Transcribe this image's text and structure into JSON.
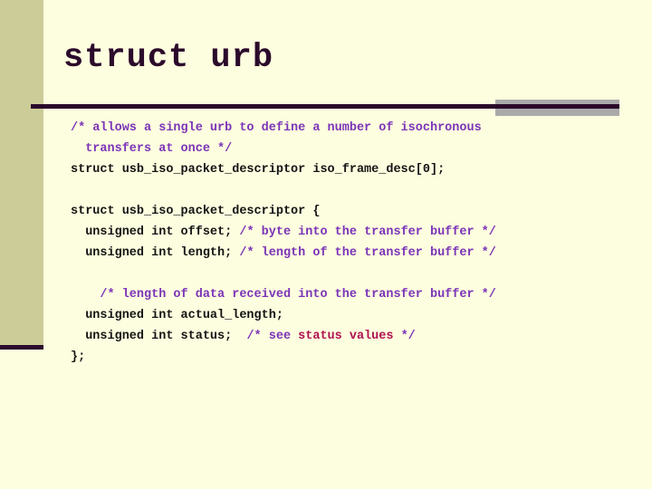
{
  "slide": {
    "title": "struct urb",
    "colors": {
      "background": "#fdfddf",
      "sidebar": "#cccc99",
      "sidebar_cap": "#2b0a2b",
      "title_text": "#2b0a2b",
      "rule": "#2b0a2b",
      "rule_shadow": "#aaaaaa",
      "code_text": "#141414",
      "comment_text": "#7b34b8",
      "status_text": "#b01050"
    }
  },
  "code": {
    "lines": [
      {
        "id": "line-1",
        "indent": 0,
        "segments": [
          {
            "style": "cmt",
            "text": "/* allows a single urb to define a number of isochronous"
          }
        ]
      },
      {
        "id": "line-2",
        "indent": 1,
        "segments": [
          {
            "style": "cmt",
            "text": "transfers at once */"
          }
        ]
      },
      {
        "id": "line-3",
        "indent": 0,
        "segments": [
          {
            "style": "kw",
            "text": "struct usb_iso_packet_descriptor iso_frame_desc[0];"
          }
        ]
      },
      {
        "id": "line-4",
        "indent": 0,
        "segments": []
      },
      {
        "id": "line-5",
        "indent": 0,
        "segments": [
          {
            "style": "kw",
            "text": "struct usb_iso_packet_descriptor {"
          }
        ]
      },
      {
        "id": "line-6",
        "indent": 1,
        "segments": [
          {
            "style": "kw",
            "text": "unsigned int offset; "
          },
          {
            "style": "cmt",
            "text": "/* byte into the transfer buffer */"
          }
        ]
      },
      {
        "id": "line-7",
        "indent": 1,
        "segments": [
          {
            "style": "kw",
            "text": "unsigned int length; "
          },
          {
            "style": "cmt",
            "text": "/* length of the transfer buffer */"
          }
        ]
      },
      {
        "id": "line-8",
        "indent": 0,
        "segments": []
      },
      {
        "id": "line-9",
        "indent": 2,
        "segments": [
          {
            "style": "cmt",
            "text": "/* length of data received into the transfer buffer */"
          }
        ]
      },
      {
        "id": "line-10",
        "indent": 1,
        "segments": [
          {
            "style": "kw",
            "text": "unsigned int actual_length;"
          }
        ]
      },
      {
        "id": "line-11",
        "indent": 1,
        "segments": [
          {
            "style": "kw",
            "text": "unsigned int status;  "
          },
          {
            "style": "cmt",
            "text": "/* see "
          },
          {
            "style": "status",
            "text": "status values"
          },
          {
            "style": "cmt",
            "text": " */"
          }
        ]
      },
      {
        "id": "line-12",
        "indent": 0,
        "segments": [
          {
            "style": "kw",
            "text": "};"
          }
        ]
      }
    ]
  }
}
